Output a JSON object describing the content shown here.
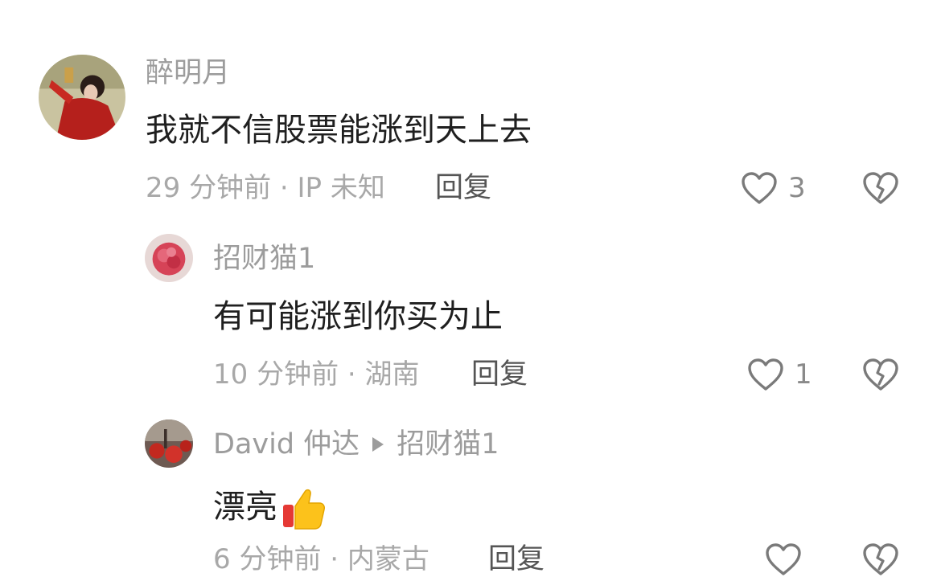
{
  "comments": [
    {
      "username": "醉明月",
      "text": "我就不信股票能涨到天上去",
      "time_location": "29 分钟前 · IP 未知",
      "reply_label": "回复",
      "likes": "3"
    },
    {
      "username": "招财猫1",
      "text": "有可能涨到你买为止",
      "time_location": "10 分钟前 · 湖南",
      "reply_label": "回复",
      "likes": "1"
    },
    {
      "username": "David 仲达",
      "reply_to": "招财猫1",
      "text": "漂亮",
      "emoji": "thumbs-up",
      "time_location": "6 分钟前 · 内蒙古",
      "reply_label": "回复",
      "likes": ""
    }
  ],
  "colors": {
    "username": "#9c9c9c",
    "content": "#1f1f1f",
    "meta": "#a8a8a8",
    "icon": "#7a7a7a"
  }
}
